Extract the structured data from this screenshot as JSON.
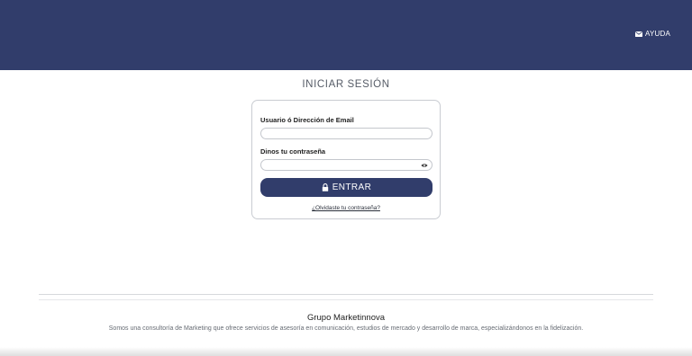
{
  "header": {
    "help_label": "AYUDA",
    "help_icon": "envelope-icon"
  },
  "login": {
    "title": "INICIAR SESIÓN",
    "user_label": "Usuario ó Dirección de Email",
    "user_value": "",
    "password_label": "Dinos tu contraseña",
    "password_value": "",
    "password_icon": "eye-icon",
    "submit_label": "ENTRAR",
    "submit_icon": "lock-icon",
    "forgot_link": "¿Olvidaste tu contraseña?"
  },
  "footer": {
    "title": "Grupo Marketinnova",
    "description": "Somos una consultoría de Marketing que ofrece servicios de asesoría en comunicación, estudios de mercado y desarrollo de marca, especializándonos en la fidelización."
  },
  "colors": {
    "brand": "#313d6b",
    "background": "#ffffff"
  }
}
